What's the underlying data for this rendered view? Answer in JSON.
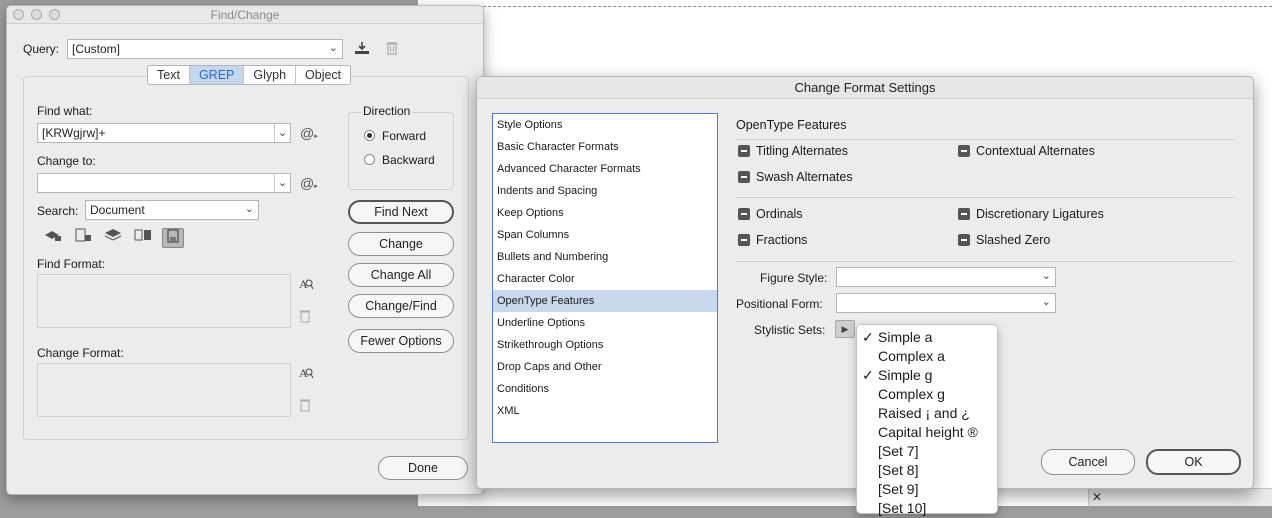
{
  "find_change": {
    "title": "Find/Change",
    "query_label": "Query:",
    "query_value": "[Custom]",
    "tabs": [
      {
        "label": "Text",
        "active": false
      },
      {
        "label": "GREP",
        "active": true
      },
      {
        "label": "Glyph",
        "active": false
      },
      {
        "label": "Object",
        "active": false
      }
    ],
    "find_what_label": "Find what:",
    "find_what_value": "[KRWgjrw]+",
    "change_to_label": "Change to:",
    "change_to_value": "",
    "at_symbol": "@",
    "direction_label": "Direction",
    "forward_label": "Forward",
    "backward_label": "Backward",
    "direction_selected": "Forward",
    "search_label": "Search:",
    "search_value": "Document",
    "find_format_label": "Find Format:",
    "change_format_label": "Change Format:",
    "buttons": {
      "find_next": "Find Next",
      "change": "Change",
      "change_all": "Change All",
      "change_find": "Change/Find",
      "fewer_options": "Fewer Options",
      "done": "Done"
    }
  },
  "change_format_settings": {
    "title": "Change Format Settings",
    "categories": [
      "Style Options",
      "Basic Character Formats",
      "Advanced Character Formats",
      "Indents and Spacing",
      "Keep Options",
      "Span Columns",
      "Bullets and Numbering",
      "Character Color",
      "OpenType Features",
      "Underline Options",
      "Strikethrough Options",
      "Drop Caps and Other",
      "Conditions",
      "XML"
    ],
    "selected_category": "OpenType Features",
    "section_title": "OpenType Features",
    "features": {
      "titling_alternates": "Titling Alternates",
      "contextual_alternates": "Contextual Alternates",
      "swash_alternates": "Swash Alternates",
      "ordinals": "Ordinals",
      "discretionary_ligatures": "Discretionary Ligatures",
      "fractions": "Fractions",
      "slashed_zero": "Slashed Zero"
    },
    "figure_style_label": "Figure Style:",
    "figure_style_value": "",
    "positional_form_label": "Positional Form:",
    "positional_form_value": "",
    "stylistic_sets_label": "Stylistic Sets:",
    "cancel_label": "Cancel",
    "ok_label": "OK"
  },
  "stylistic_sets_menu": {
    "check_glyph": "✓",
    "items": [
      {
        "label": "Simple a",
        "checked": true
      },
      {
        "label": "Complex a",
        "checked": false
      },
      {
        "label": "Simple g",
        "checked": true
      },
      {
        "label": "Complex g",
        "checked": false
      },
      {
        "label": "Raised ¡ and ¿",
        "checked": false
      },
      {
        "label": "Capital height ®",
        "checked": false
      },
      {
        "label": "[Set 7]",
        "checked": false
      },
      {
        "label": "[Set 8]",
        "checked": false
      },
      {
        "label": "[Set 9]",
        "checked": false
      },
      {
        "label": "[Set 10]",
        "checked": false
      }
    ]
  },
  "icons": {
    "chevron": "chevron-down-icon",
    "save_query": "save-query-icon",
    "delete_query": "trash-icon",
    "special_char": "at-sign-icon",
    "specify_format": "format-search-icon",
    "clear_format": "trash-icon"
  }
}
